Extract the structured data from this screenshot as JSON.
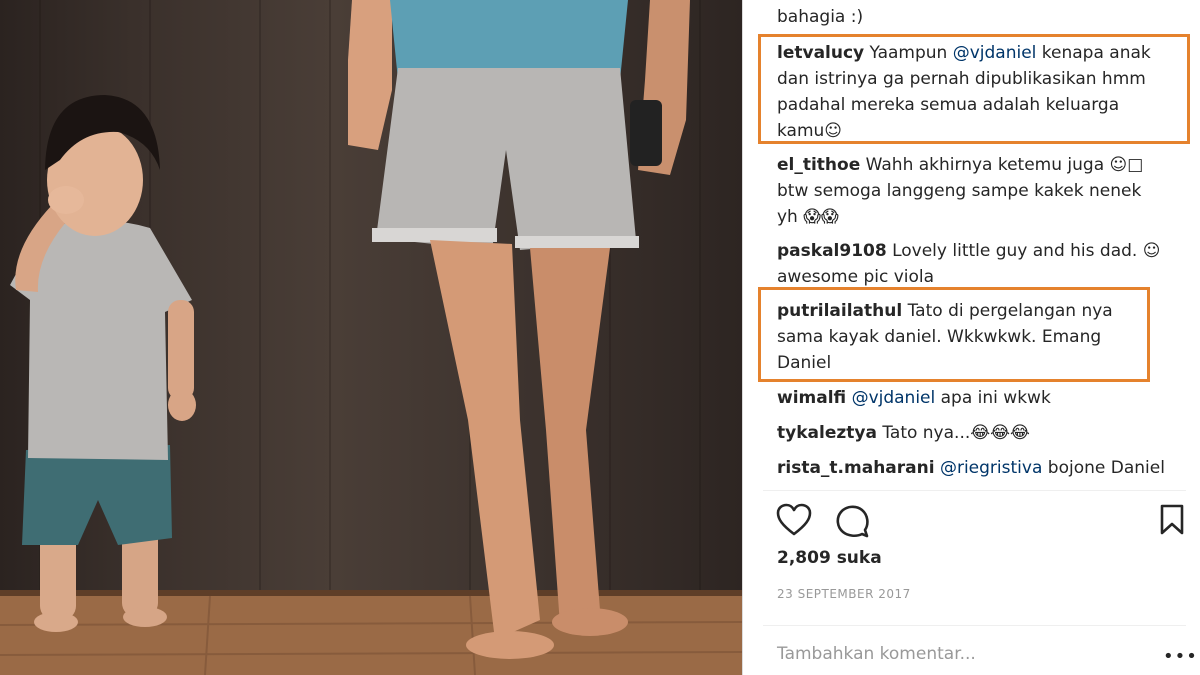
{
  "comments": [
    {
      "lines": [
        "bahagia :)"
      ]
    },
    {
      "user": "letvalucy",
      "text_a": " Yaampun ",
      "mention": "@vjdaniel",
      "text_b": " kenapa anak",
      "lines": [
        "dan istrinya ga pernah dipublikasikan hmm",
        "padahal mereka semua adalah keluarga",
        "kamu☺"
      ]
    },
    {
      "user": "el_tithoe",
      "text_a": " Wahh akhirnya ketemu juga ☺□",
      "lines": [
        "btw semoga langgeng sampe kakek nenek",
        "yh 😱😱"
      ]
    },
    {
      "user": "paskal9108",
      "text_a": " Lovely little guy and his dad. ☺",
      "lines": [
        "awesome pic viola"
      ]
    },
    {
      "user": "putrilailathul",
      "text_a": " Tato di pergelangan nya",
      "lines": [
        "sama kayak daniel. Wkkwkwk. Emang",
        "Daniel"
      ]
    },
    {
      "user": "wimalfi",
      "mention": "@vjdaniel",
      "text_b": " apa ini wkwk"
    },
    {
      "user": "tykaleztya",
      "text_a": " Tato nya...😂😂😂"
    },
    {
      "user": "rista_t.maharani",
      "mention": "@riegristiva",
      "text_b": " bojone Daniel"
    }
  ],
  "actions": {
    "like_icon": "heart-icon",
    "comment_icon": "speech-bubble-icon",
    "save_icon": "bookmark-icon"
  },
  "likes_text": "2,809 suka",
  "date_text": "23 SEPTEMBER 2017",
  "add_comment_placeholder": "Tambahkan komentar...",
  "more_label": "•••",
  "colors": {
    "highlight": "#e5822d",
    "mention": "#003569",
    "text": "#262626",
    "muted": "#999999"
  }
}
